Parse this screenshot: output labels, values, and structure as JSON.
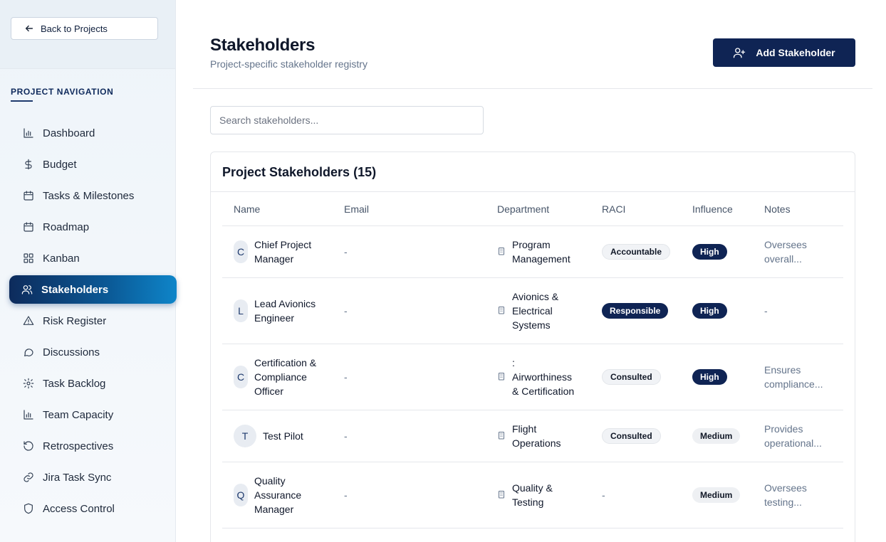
{
  "sidebar": {
    "back_label": "Back to Projects",
    "heading": "PROJECT NAVIGATION",
    "items": [
      {
        "label": "Dashboard",
        "icon": "bar-chart-icon"
      },
      {
        "label": "Budget",
        "icon": "dollar-icon"
      },
      {
        "label": "Tasks & Milestones",
        "icon": "calendar-icon"
      },
      {
        "label": "Roadmap",
        "icon": "calendar-icon"
      },
      {
        "label": "Kanban",
        "icon": "grid-icon"
      },
      {
        "label": "Stakeholders",
        "icon": "users-icon",
        "active": true
      },
      {
        "label": "Risk Register",
        "icon": "warning-icon"
      },
      {
        "label": "Discussions",
        "icon": "chat-icon"
      },
      {
        "label": "Task Backlog",
        "icon": "gear-icon"
      },
      {
        "label": "Team Capacity",
        "icon": "bar-chart-icon"
      },
      {
        "label": "Retrospectives",
        "icon": "rotate-icon"
      },
      {
        "label": "Jira Task Sync",
        "icon": "link-icon"
      },
      {
        "label": "Access Control",
        "icon": "shield-icon"
      }
    ]
  },
  "header": {
    "title": "Stakeholders",
    "subtitle": "Project-specific stakeholder registry",
    "add_button": "Add Stakeholder"
  },
  "search": {
    "placeholder": "Search stakeholders..."
  },
  "table": {
    "title": "Project Stakeholders (15)",
    "columns": [
      "Name",
      "Email",
      "Department",
      "RACI",
      "Influence",
      "Notes"
    ],
    "rows": [
      {
        "initial": "C",
        "name_lines": [
          "Chief Project",
          "Manager"
        ],
        "email": "-",
        "dept_lines": [
          "Program",
          "Management"
        ],
        "raci": "Accountable",
        "influence": "High",
        "notes_lines": [
          "Oversees",
          "overall..."
        ]
      },
      {
        "initial": "L",
        "name_lines": [
          "Lead Avionics",
          "Engineer"
        ],
        "email": "-",
        "dept_lines": [
          "Avionics &",
          "Electrical",
          "Systems"
        ],
        "raci": "Responsible",
        "influence": "High",
        "notes_lines": [
          "-"
        ]
      },
      {
        "initial": "C",
        "name_lines": [
          "Certification &",
          "Compliance",
          "Officer"
        ],
        "email": "-",
        "dept_lines": [
          ":",
          "Airworthiness",
          "& Certification"
        ],
        "raci": "Consulted",
        "influence": "High",
        "notes_lines": [
          "Ensures",
          "compliance..."
        ]
      },
      {
        "initial": "T",
        "name_lines": [
          "Test Pilot"
        ],
        "email": "-",
        "dept_lines": [
          "Flight",
          "Operations"
        ],
        "raci": "Consulted",
        "influence": "Medium",
        "notes_lines": [
          "Provides",
          "operational..."
        ]
      },
      {
        "initial": "Q",
        "name_lines": [
          "Quality",
          "Assurance",
          "Manager"
        ],
        "email": "-",
        "dept_lines": [
          "Quality &",
          "Testing"
        ],
        "raci": "-",
        "influence": "Medium",
        "notes_lines": [
          "Oversees",
          "testing..."
        ]
      }
    ]
  },
  "colors": {
    "primary": "#0f2454",
    "active_gradient_start": "#0d2b5c",
    "active_gradient_end": "#0e85c9",
    "muted_text": "#64748b"
  }
}
